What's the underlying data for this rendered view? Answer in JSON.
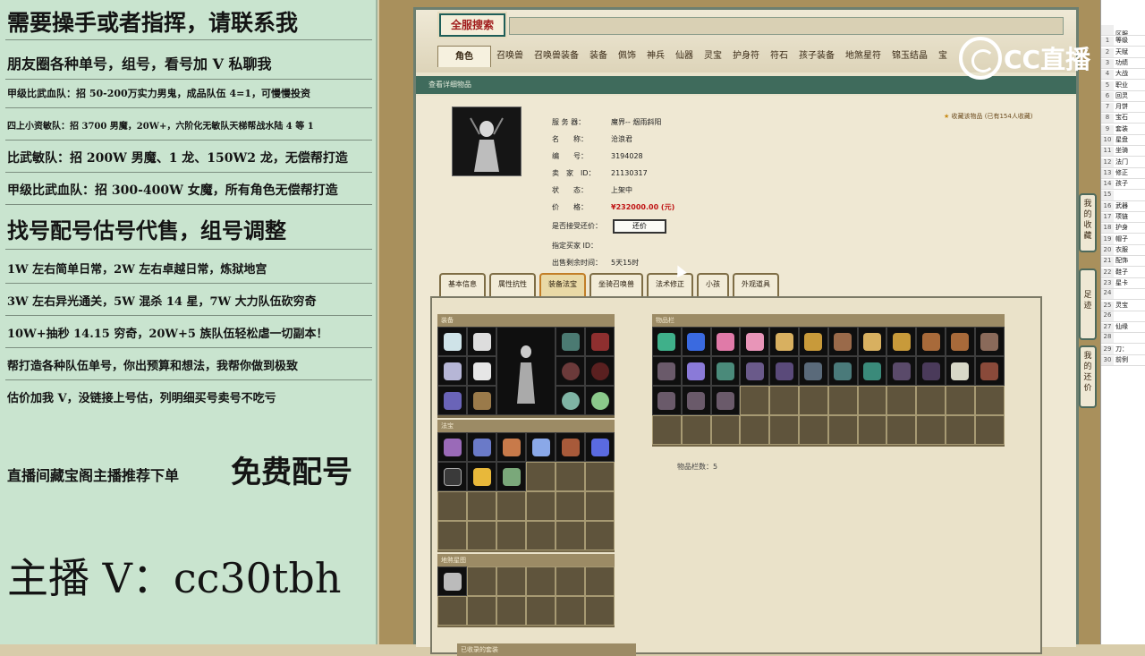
{
  "promo": {
    "lines": [
      "需要操手或者指挥，请联系我",
      "朋友圈各种单号，组号，看号加 V 私聊我",
      "甲级比武血队：招 50-200万实力男鬼，成品队伍 4=1，可慢慢投资",
      "四上小资敏队：招 3700 男魔，20W+，六阶化无敏队天梯帮战水陆 4 等 1",
      "比武敏队：招 200W 男魔、1 龙、150W2 龙，无偿帮打造",
      "甲级比武血队：招 300-400W 女魔，所有角色无偿帮打造",
      "找号配号估号代售，组号调整",
      "1W 左右简单日常，2W 左右卓越日常，炼狱地宫",
      "3W 左右异光通关，5W 混杀 14 星，7W 大力队伍砍穷奇",
      "10W+抽秒 14.15 穷奇，20W+5 族队伍轻松虐一切副本！",
      "帮打造各种队伍单号，你出预算和想法，我帮你做到极致",
      "估价加我 V，没链接上号估，列明细买号卖号不吃亏",
      "直播间藏宝阁主播推荐下单",
      "免费配号",
      "主播 V：cc30tbh"
    ]
  },
  "game": {
    "title_badge": "全服搜索",
    "tabs": [
      "角色",
      "召唤兽",
      "召唤兽装备",
      "装备",
      "佩饰",
      "神兵",
      "仙器",
      "灵宝",
      "护身符",
      "符石",
      "孩子装备",
      "地煞星符",
      "锦玉结晶",
      "宝"
    ],
    "subbar": "查看详细物品",
    "info": {
      "server_label": "服 务 器：",
      "server": "魔界-- 烟雨斜阳",
      "name_label": "名　　称：",
      "name": "沧浪君",
      "id_label": "编　　号：",
      "id": "3194028",
      "seller_label": "卖　家　ID：",
      "seller": "21130317",
      "state_label": "状　　态：",
      "state": "上架中",
      "price_label": "价　　格：",
      "price": "¥232000.00 (元)",
      "bargain_label": "是否接受还价：",
      "bargain_btn": "还价",
      "buyer_label": "指定买家 ID：",
      "buyer": "",
      "time_label": "出售剩余时间：",
      "time": "5天15时"
    },
    "favorite": "收藏该物品",
    "favorite_count": "(已有154人收藏)",
    "info_tabs": [
      "基本信息",
      "属性抗性",
      "装备法宝",
      "坐骑召唤兽",
      "法术修正",
      "小孩",
      "外观道具"
    ],
    "equip_header": "装备",
    "fabao_header": "法宝",
    "dixing_header": "地煞星图",
    "items_header": "物品栏",
    "slot_count": "物品栏数：5",
    "bottom_header": "已收录的套装"
  },
  "side_tabs": [
    "我的收藏",
    "足迹",
    "我的还价"
  ],
  "watermark": "CC直播",
  "sheet": [
    [
      "",
      "区服"
    ],
    [
      "1",
      "等级"
    ],
    [
      "2",
      "天赋"
    ],
    [
      "3",
      "功绩"
    ],
    [
      "4",
      "大战"
    ],
    [
      "5",
      "职业"
    ],
    [
      "6",
      "回灵"
    ],
    [
      "7",
      "月饼"
    ],
    [
      "8",
      "宝石"
    ],
    [
      "9",
      "套装"
    ],
    [
      "10",
      "星盘"
    ],
    [
      "11",
      "坐骑"
    ],
    [
      "12",
      "法门"
    ],
    [
      "13",
      "修正"
    ],
    [
      "14",
      "孩子"
    ],
    [
      "15",
      ""
    ],
    [
      "16",
      "武器"
    ],
    [
      "17",
      "项链"
    ],
    [
      "18",
      "护身"
    ],
    [
      "19",
      "帽子"
    ],
    [
      "20",
      "衣服"
    ],
    [
      "21",
      "配饰"
    ],
    [
      "22",
      "鞋子"
    ],
    [
      "23",
      "星卡"
    ],
    [
      "24",
      ""
    ],
    [
      "25",
      "灵宝"
    ],
    [
      "26",
      ""
    ],
    [
      "27",
      "仙缘"
    ],
    [
      "28",
      ""
    ],
    [
      "29",
      "刀："
    ],
    [
      "30",
      "前例"
    ]
  ],
  "colors": {
    "promo_bg": "#c9e4cf",
    "price": "#c01616",
    "tab_bar": "#3f6b5c"
  }
}
